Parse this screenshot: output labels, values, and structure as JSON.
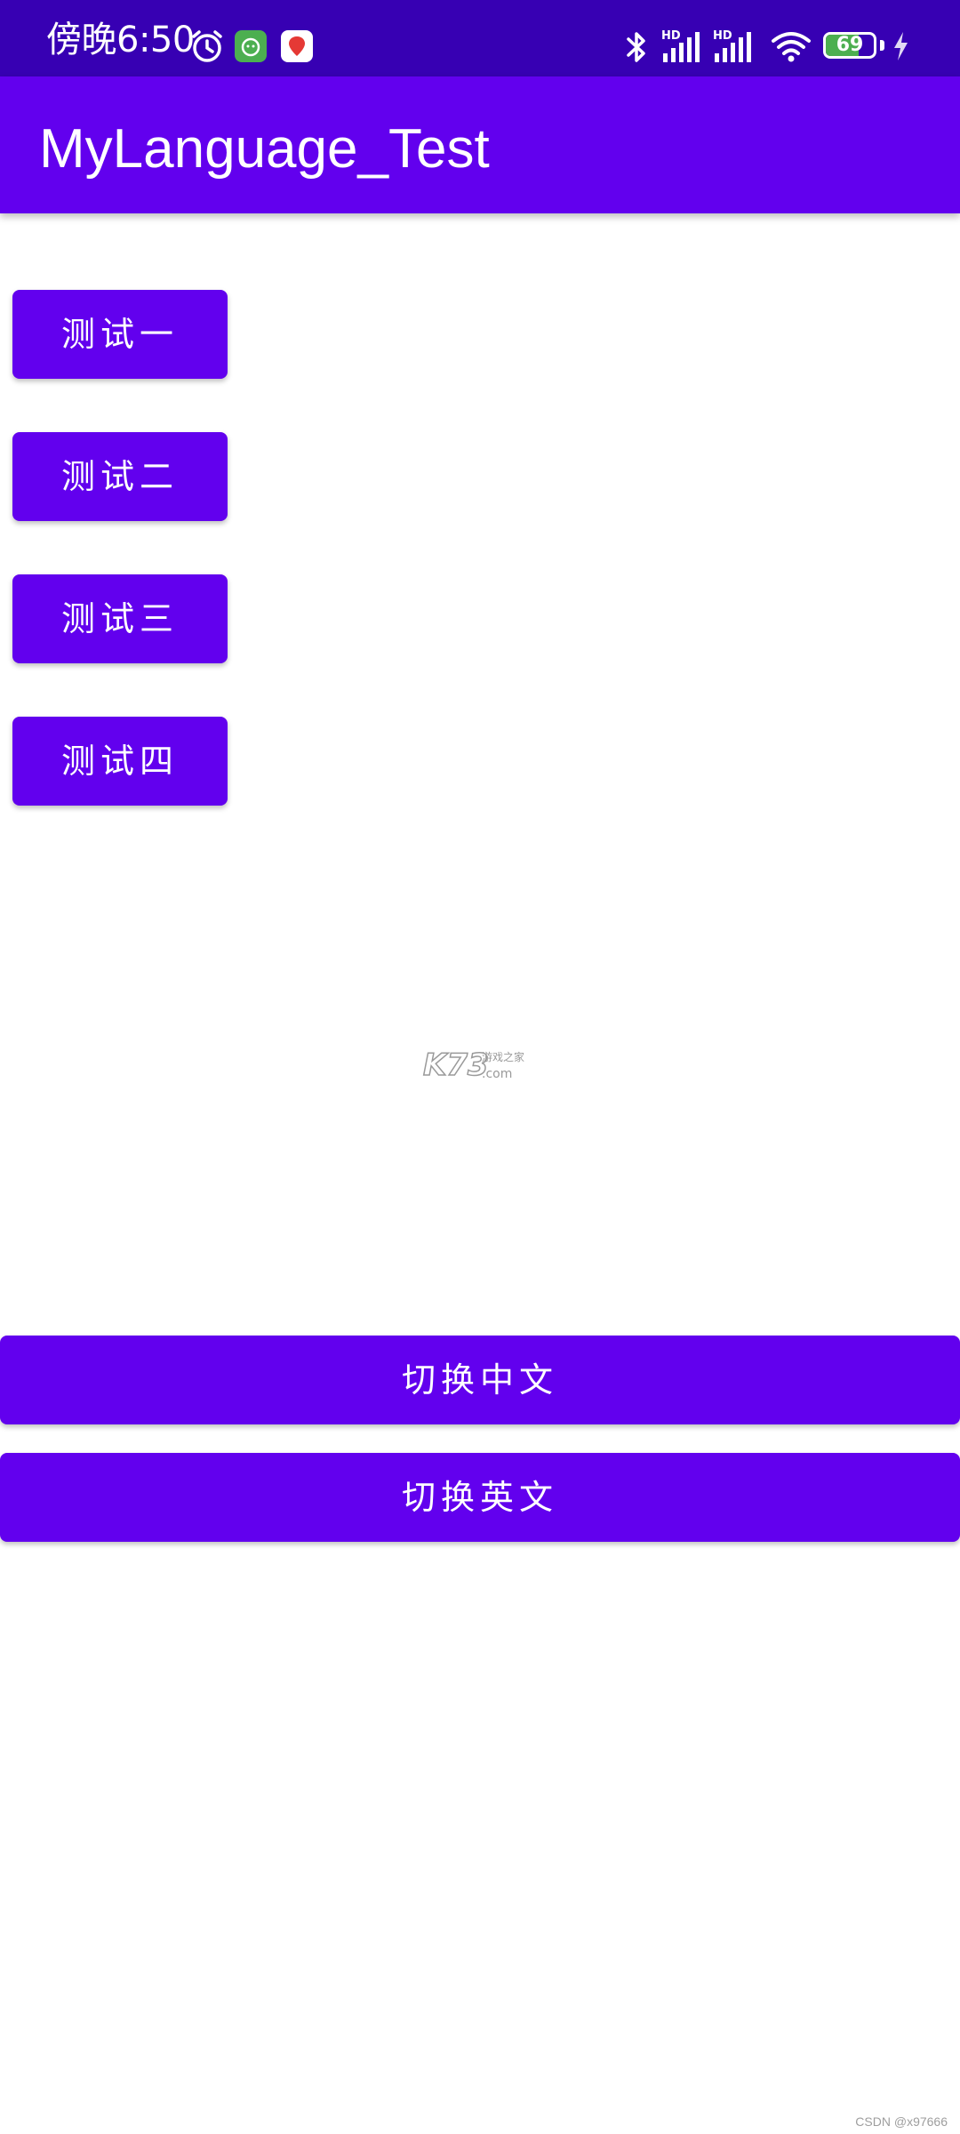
{
  "status_bar": {
    "time": "傍晚6:50",
    "battery_level": "69",
    "network_1": "HD",
    "network_2": "HD",
    "icons": [
      "alarm-icon",
      "app-notification-icon",
      "app-notification-icon",
      "bluetooth-icon",
      "signal-icon",
      "signal-icon",
      "wifi-icon",
      "battery-icon",
      "charging-icon"
    ]
  },
  "app_bar": {
    "title": "MyLanguage_Test"
  },
  "main": {
    "buttons": [
      {
        "label": "测试一"
      },
      {
        "label": "测试二"
      },
      {
        "label": "测试三"
      },
      {
        "label": "测试四"
      }
    ],
    "switch_chinese_label": "切换中文",
    "switch_english_label": "切换英文"
  },
  "watermark": {
    "logo": "K73",
    "subtitle": "游戏之家",
    "domain": ".com"
  },
  "credit": "CSDN @x97666",
  "colors": {
    "status_bar": "#3700B3",
    "primary": "#6200EE",
    "background": "#FFFFFF",
    "on_primary": "#FFFFFF"
  }
}
